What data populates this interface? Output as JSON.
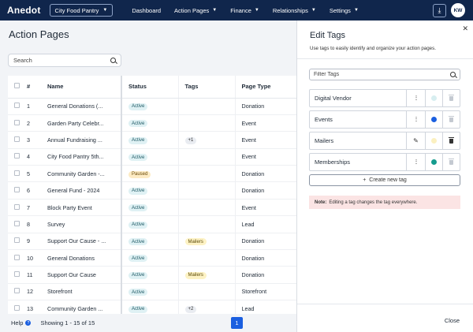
{
  "topbar": {
    "logo": "Anedot",
    "org": "City Food Pantry",
    "nav": [
      {
        "label": "Dashboard",
        "has_caret": false
      },
      {
        "label": "Action Pages",
        "has_caret": true
      },
      {
        "label": "Finance",
        "has_caret": true
      },
      {
        "label": "Relationships",
        "has_caret": true
      },
      {
        "label": "Settings",
        "has_caret": true
      }
    ],
    "avatar": "KW",
    "icons": {
      "download": "download-icon",
      "caret": "chevron-down-icon"
    }
  },
  "main": {
    "title": "Action Pages",
    "search_placeholder": "Search",
    "columns": {
      "num": "#",
      "name": "Name",
      "status": "Status",
      "tags": "Tags",
      "type": "Page Type"
    },
    "rows": [
      {
        "num": "1",
        "name": "General Donations (...",
        "status": "Active",
        "tag": "",
        "type": "Donation"
      },
      {
        "num": "2",
        "name": "Garden Party Celebr...",
        "status": "Active",
        "tag": "",
        "type": "Event"
      },
      {
        "num": "3",
        "name": "Annual Fundraising ...",
        "status": "Active",
        "tag": "+1",
        "type": "Event"
      },
      {
        "num": "4",
        "name": "City Food Pantry 5th...",
        "status": "Active",
        "tag": "",
        "type": "Event"
      },
      {
        "num": "5",
        "name": "Community Garden -...",
        "status": "Paused",
        "tag": "",
        "type": "Donation"
      },
      {
        "num": "6",
        "name": "General Fund - 2024",
        "status": "Active",
        "tag": "",
        "type": "Donation"
      },
      {
        "num": "7",
        "name": "Block Party Event",
        "status": "Active",
        "tag": "",
        "type": "Event"
      },
      {
        "num": "8",
        "name": "Survey",
        "status": "Active",
        "tag": "",
        "type": "Lead"
      },
      {
        "num": "9",
        "name": "Support Our Cause - ...",
        "status": "Active",
        "tag": "Mailers",
        "type": "Donation"
      },
      {
        "num": "10",
        "name": "General Donations",
        "status": "Active",
        "tag": "",
        "type": "Donation"
      },
      {
        "num": "11",
        "name": "Support Our Cause",
        "status": "Active",
        "tag": "Mailers",
        "type": "Donation"
      },
      {
        "num": "12",
        "name": "Storefront",
        "status": "Active",
        "tag": "",
        "type": "Storefront"
      },
      {
        "num": "13",
        "name": "Community Garden ...",
        "status": "Active",
        "tag": "+2",
        "type": "Lead"
      }
    ],
    "footer": {
      "help": "Help",
      "help_icon": "?",
      "showing": "Showing 1 - 15 of 15",
      "page": "1"
    }
  },
  "panel": {
    "title": "Edit Tags",
    "description": "Use tags to easily identify and organize your action pages.",
    "filter_placeholder": "Filter Tags",
    "tags": [
      {
        "name": "Digital Vendor",
        "color": "#d7eef0",
        "editing": false
      },
      {
        "name": "Events",
        "color": "#1b5fe0",
        "editing": false
      },
      {
        "name": "Mailers",
        "color": "#fbf0c0",
        "editing": true
      },
      {
        "name": "Memberships",
        "color": "#169c8e",
        "editing": false
      }
    ],
    "create_label": "Create new tag",
    "note_label": "Note:",
    "note_text": "Editing a tag changes the tag everywhere.",
    "close_label": "Close"
  }
}
